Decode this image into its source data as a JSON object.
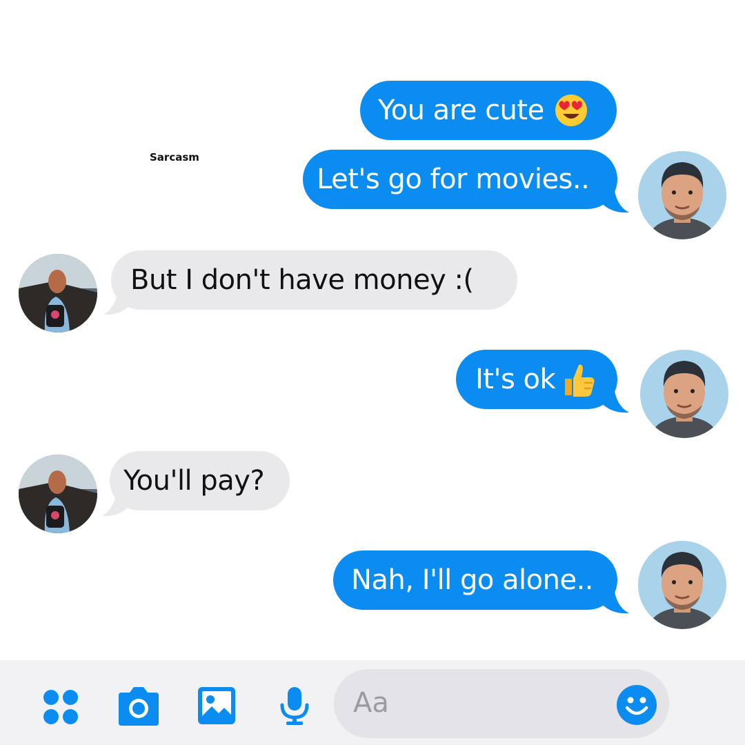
{
  "watermark": "Sarcasm",
  "messages": [
    {
      "sender": "me",
      "text": "You are cute",
      "emoji": "heart-eyes-emoji"
    },
    {
      "sender": "me",
      "text": "Let's go for movies.."
    },
    {
      "sender": "them",
      "text": "But I don't have money :("
    },
    {
      "sender": "me",
      "text": "It's ok",
      "emoji": "thumbs-up-emoji"
    },
    {
      "sender": "them",
      "text": "You'll pay?"
    },
    {
      "sender": "me",
      "text": "Nah, I'll go alone.."
    }
  ],
  "composer": {
    "placeholder": "Aa",
    "icons": [
      "apps-grid-icon",
      "camera-icon",
      "gallery-icon",
      "microphone-icon",
      "emoji-icon"
    ]
  },
  "colors": {
    "outgoing_bubble": "#0a8cf0",
    "incoming_bubble": "#e9e9ec",
    "accent": "#0a8cf0",
    "composer_bg": "#f2f2f4"
  }
}
